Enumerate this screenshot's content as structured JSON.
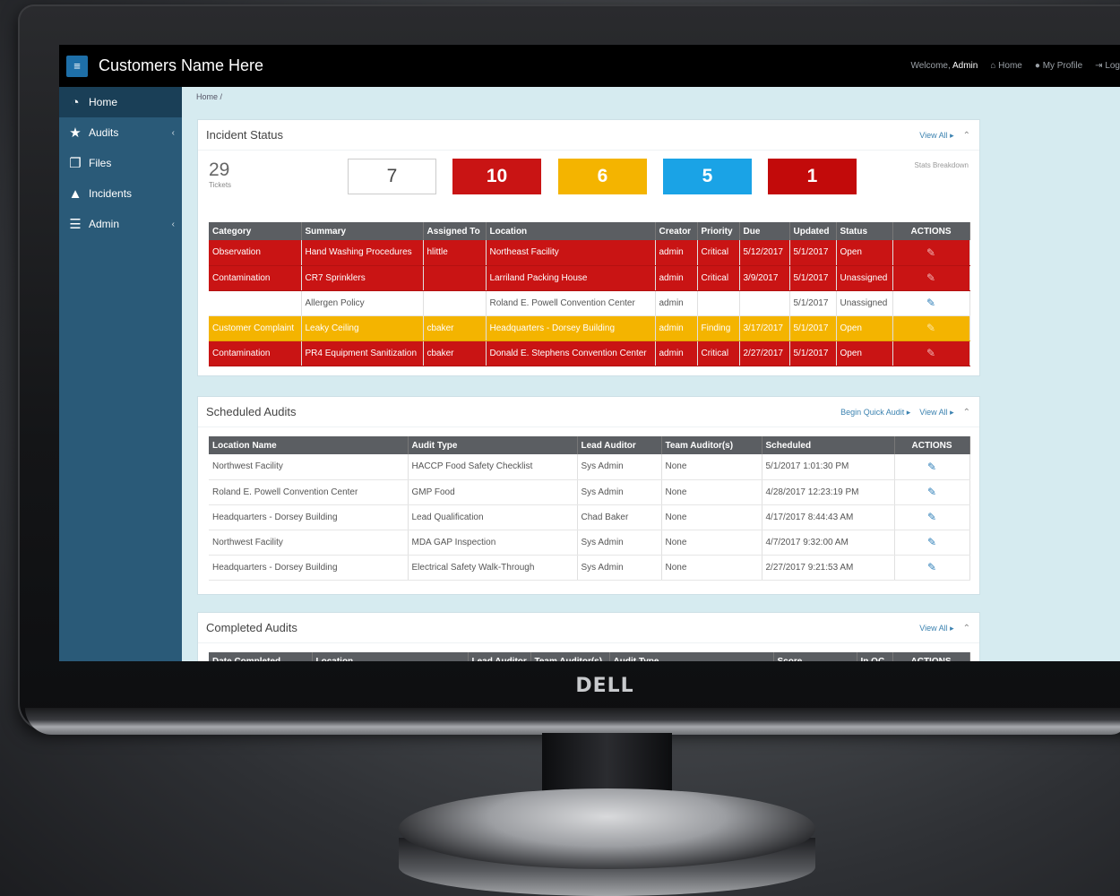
{
  "app": {
    "brand": "Customers Name Here",
    "menu_icon": "hamburger-icon",
    "monitor_logo": "DELL"
  },
  "topbar": {
    "welcome": "Welcome,",
    "user": "Admin",
    "home": "Home",
    "profile": "My Profile",
    "logout": "Log"
  },
  "sidebar": {
    "items": [
      {
        "label": "Home",
        "icon": "dashboard-icon"
      },
      {
        "label": "Audits",
        "icon": "star-icon"
      },
      {
        "label": "Files",
        "icon": "files-icon"
      },
      {
        "label": "Incidents",
        "icon": "warning-icon"
      },
      {
        "label": "Admin",
        "icon": "sliders-icon"
      }
    ]
  },
  "breadcrumb": "Home /",
  "incident_status": {
    "title": "Incident Status",
    "view_all": "View All ▸",
    "tickets_count": "29",
    "tickets_label": "Tickets",
    "stats_breakdown": "Stats Breakdown",
    "stats": [
      "7",
      "10",
      "6",
      "5",
      "1"
    ],
    "colors": {
      "red": "#c91414",
      "yellow": "#f4b400",
      "blue": "#1aa3e6",
      "dark_red": "#c20a0a"
    },
    "columns": [
      "Category",
      "Summary",
      "Assigned To",
      "Location",
      "Creator",
      "Priority",
      "Due",
      "Updated",
      "Status",
      "ACTIONS"
    ],
    "rows": [
      {
        "category": "Observation",
        "summary": "Hand Washing Procedures",
        "assigned": "hlittle",
        "location": "Northeast Facility",
        "creator": "admin",
        "priority": "Critical",
        "due": "5/12/2017",
        "updated": "5/1/2017",
        "status": "Open"
      },
      {
        "category": "Contamination",
        "summary": "CR7 Sprinklers",
        "assigned": "",
        "location": "Larriland Packing House",
        "creator": "admin",
        "priority": "Critical",
        "due": "3/9/2017",
        "updated": "5/1/2017",
        "status": "Unassigned"
      },
      {
        "category": "",
        "summary": "Allergen Policy",
        "assigned": "",
        "location": "Roland E. Powell Convention Center",
        "creator": "admin",
        "priority": "",
        "due": "",
        "updated": "5/1/2017",
        "status": "Unassigned"
      },
      {
        "category": "Customer Complaint",
        "summary": "Leaky Ceiling",
        "assigned": "cbaker",
        "location": "Headquarters - Dorsey Building",
        "creator": "admin",
        "priority": "Finding",
        "due": "3/17/2017",
        "updated": "5/1/2017",
        "status": "Open"
      },
      {
        "category": "Contamination",
        "summary": "PR4 Equipment Sanitization",
        "assigned": "cbaker",
        "location": "Donald E. Stephens Convention Center",
        "creator": "admin",
        "priority": "Critical",
        "due": "2/27/2017",
        "updated": "5/1/2017",
        "status": "Open"
      }
    ]
  },
  "scheduled_audits": {
    "title": "Scheduled Audits",
    "quick_audit": "Begin Quick Audit ▸",
    "view_all": "View All ▸",
    "columns": [
      "Location Name",
      "Audit Type",
      "Lead Auditor",
      "Team Auditor(s)",
      "Scheduled",
      "ACTIONS"
    ],
    "rows": [
      {
        "location": "Northwest Facility",
        "type": "HACCP Food Safety Checklist",
        "lead": "Sys Admin",
        "team": "None",
        "scheduled": "5/1/2017 1:01:30 PM"
      },
      {
        "location": "Roland E. Powell Convention Center",
        "type": "GMP Food",
        "lead": "Sys Admin",
        "team": "None",
        "scheduled": "4/28/2017 12:23:19 PM"
      },
      {
        "location": "Headquarters - Dorsey Building",
        "type": "Lead Qualification",
        "lead": "Chad Baker",
        "team": "None",
        "scheduled": "4/17/2017 8:44:43 AM"
      },
      {
        "location": "Northwest Facility",
        "type": "MDA GAP Inspection",
        "lead": "Sys Admin",
        "team": "None",
        "scheduled": "4/7/2017 9:32:00 AM"
      },
      {
        "location": "Headquarters - Dorsey Building",
        "type": "Electrical Safety Walk-Through",
        "lead": "Sys Admin",
        "team": "None",
        "scheduled": "2/27/2017 9:21:53 AM"
      }
    ]
  },
  "completed_audits": {
    "title": "Completed Audits",
    "view_all": "View All ▸",
    "columns": [
      "Date Completed",
      "Location",
      "Lead Auditor",
      "Team Auditor(s)",
      "Audit Type",
      "Score",
      "In QC",
      "ACTIONS"
    ]
  }
}
